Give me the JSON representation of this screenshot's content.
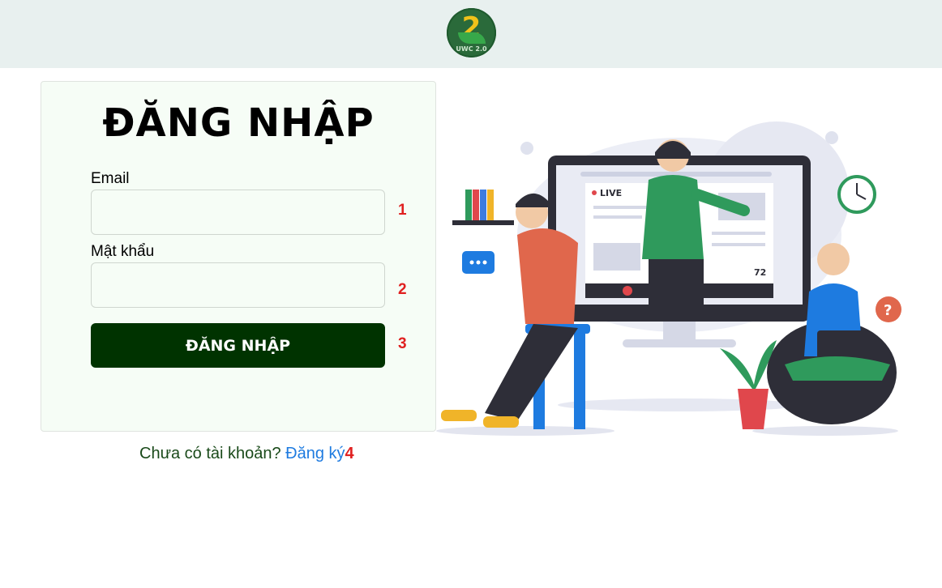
{
  "logo": {
    "number": "2",
    "text": "UWC 2.0"
  },
  "login": {
    "title": "ĐĂNG NHẬP",
    "email_label": "Email",
    "email_value": "",
    "password_label": "Mật khẩu",
    "password_value": "",
    "submit_label": "ĐĂNG NHẬP"
  },
  "markers": [
    "1",
    "2",
    "3",
    "4"
  ],
  "signup": {
    "prompt": "Chưa có tài khoản?",
    "link": "Đăng ký"
  },
  "illustration": {
    "live_label": "LIVE",
    "viewer_count": "72"
  },
  "colors": {
    "topbar": "#e8f0ef",
    "button": "#003300",
    "link": "#1e7be0",
    "marker": "#e02020",
    "card": "#f6fdf6"
  }
}
